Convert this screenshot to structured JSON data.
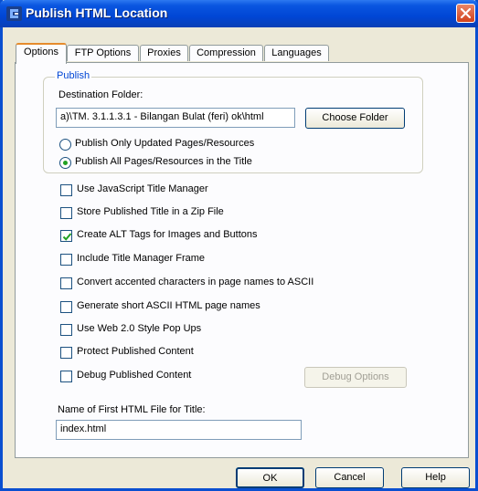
{
  "window": {
    "title": "Publish HTML Location"
  },
  "tabs": [
    {
      "label": "Options",
      "active": true
    },
    {
      "label": "FTP Options",
      "active": false
    },
    {
      "label": "Proxies",
      "active": false
    },
    {
      "label": "Compression",
      "active": false
    },
    {
      "label": "Languages",
      "active": false
    }
  ],
  "publish": {
    "group_label": "Publish",
    "destination_label": "Destination Folder:",
    "destination_value": "a)\\TM. 3.1.1.3.1 - Bilangan Bulat (feri) ok\\html",
    "choose_folder_label": "Choose Folder",
    "radio_updated_label": "Publish Only Updated Pages/Resources",
    "radio_all_label": "Publish All Pages/Resources in the Title",
    "selected_radio": "all"
  },
  "options": [
    {
      "label": "Use JavaScript Title Manager",
      "checked": false
    },
    {
      "label": "Store Published Title in a Zip File",
      "checked": false
    },
    {
      "label": "Create ALT Tags for Images and Buttons",
      "checked": true
    },
    {
      "label": "Include Title Manager Frame",
      "checked": false
    },
    {
      "label": "Convert accented characters in page names to ASCII",
      "checked": false
    },
    {
      "label": "Generate short ASCII HTML page names",
      "checked": false
    },
    {
      "label": "Use Web 2.0 Style Pop Ups",
      "checked": false
    },
    {
      "label": "Protect Published Content",
      "checked": false
    },
    {
      "label": "Debug Published Content",
      "checked": false
    }
  ],
  "debug_options_label": "Debug Options",
  "first_file": {
    "label": "Name of First HTML File for Title:",
    "value": "index.html"
  },
  "footer": {
    "ok_label": "OK",
    "cancel_label": "Cancel",
    "help_label": "Help"
  },
  "colors": {
    "titlebar": "#0046d5",
    "active_tab_accent": "#e68b2c",
    "group_label": "#0046d5",
    "close_button": "#d2421c",
    "check_mark": "#21a121"
  }
}
